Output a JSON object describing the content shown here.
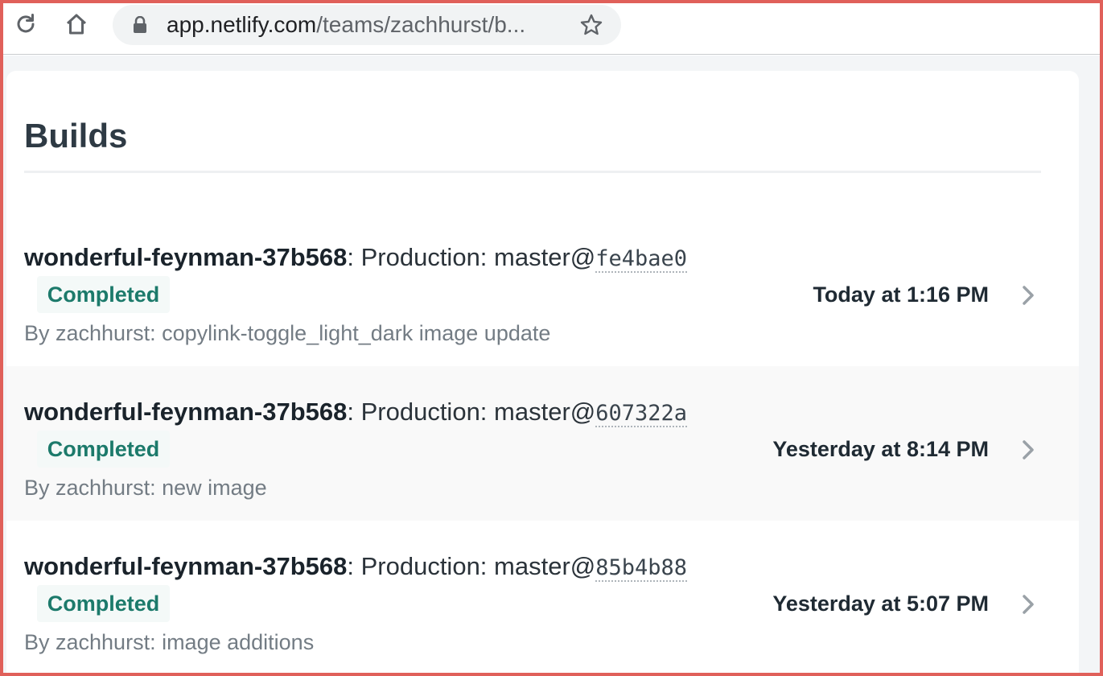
{
  "browser": {
    "url_host": "app.netlify.com",
    "url_path": "/teams/zachhurst/b...",
    "icons": [
      "reload-icon",
      "home-icon",
      "lock-icon",
      "star-icon"
    ]
  },
  "page": {
    "title": "Builds"
  },
  "builds": [
    {
      "site": "wonderful-feynman-37b568",
      "context": ": Production: master@",
      "sha": "fe4bae0",
      "status": "Completed",
      "meta": "By zachhurst: copylink-toggle_light_dark image update",
      "time": "Today at 1:16 PM"
    },
    {
      "site": "wonderful-feynman-37b568",
      "context": ": Production: master@",
      "sha": "607322a",
      "status": "Completed",
      "meta": "By zachhurst: new image",
      "time": "Yesterday at 8:14 PM"
    },
    {
      "site": "wonderful-feynman-37b568",
      "context": ": Production: master@",
      "sha": "85b4b88",
      "status": "Completed",
      "meta": "By zachhurst: image additions",
      "time": "Yesterday at 5:07 PM"
    }
  ],
  "colors": {
    "frame": "#e0605a",
    "status_text": "#1c7a6b",
    "status_bg": "#f4f9f8",
    "title": "#2e3a44"
  }
}
